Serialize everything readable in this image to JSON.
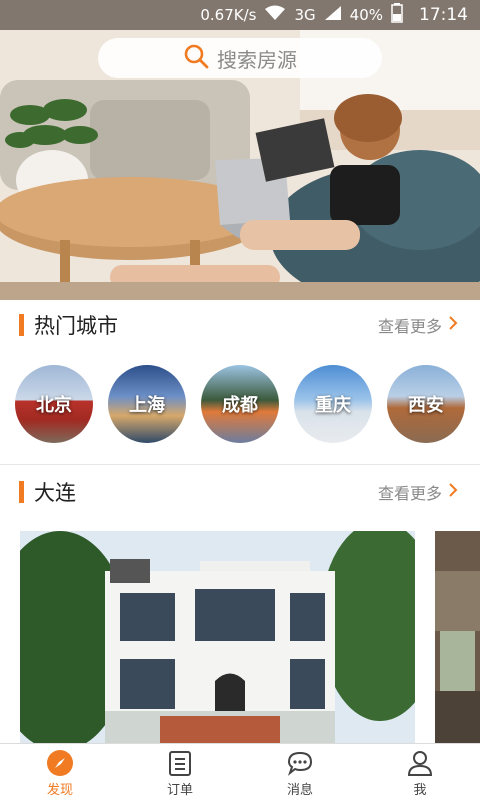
{
  "status_bar": {
    "speed": "0.67K/s",
    "network": "3G",
    "battery": "40%",
    "time": "17:14"
  },
  "search": {
    "placeholder": "搜索房源",
    "icon": "search-icon"
  },
  "hot_cities": {
    "title": "热门城市",
    "more_label": "查看更多",
    "items": [
      {
        "name": "北京"
      },
      {
        "name": "上海"
      },
      {
        "name": "成都"
      },
      {
        "name": "重庆"
      },
      {
        "name": "西安"
      }
    ]
  },
  "city_section": {
    "title": "大连",
    "more_label": "查看更多"
  },
  "tabs": [
    {
      "label": "发现",
      "icon": "compass-icon",
      "active": true
    },
    {
      "label": "订单",
      "icon": "order-list-icon",
      "active": false
    },
    {
      "label": "消息",
      "icon": "message-bubble-icon",
      "active": false
    },
    {
      "label": "我",
      "icon": "user-icon",
      "active": false
    }
  ],
  "colors": {
    "accent": "#f07b22",
    "muted_text": "#8a8a8a"
  }
}
